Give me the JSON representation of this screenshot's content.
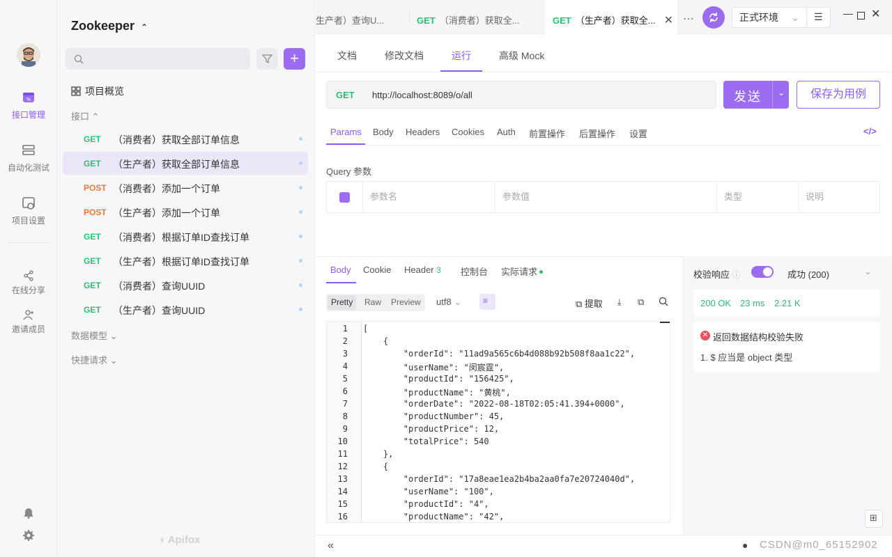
{
  "app": {
    "project_title": "Zookeeper",
    "brand": "Apifox"
  },
  "colors": {
    "accent": "#9b6cf0",
    "get": "#2fbd73",
    "post": "#ee7a32"
  },
  "rail": {
    "items": [
      {
        "label": "接口管理",
        "icon": "api-icon"
      },
      {
        "label": "自动化测试",
        "icon": "test-icon"
      },
      {
        "label": "项目设置",
        "icon": "settings-icon"
      },
      {
        "label": "在线分享",
        "icon": "share-icon"
      },
      {
        "label": "邀请成员",
        "icon": "invite-icon"
      }
    ]
  },
  "sidebar": {
    "search_placeholder": "",
    "overview": "项目概览",
    "interfaces_label": "接口",
    "data_model_label": "数据模型",
    "quick_request_label": "快捷请求",
    "apis": [
      {
        "method": "GET",
        "name": "（消费者）获取全部订单信息"
      },
      {
        "method": "GET",
        "name": "（生产者）获取全部订单信息"
      },
      {
        "method": "POST",
        "name": "（消费者）添加一个订单"
      },
      {
        "method": "POST",
        "name": "（生产者）添加一个订单"
      },
      {
        "method": "GET",
        "name": "（消费者）根据订单ID查找订单"
      },
      {
        "method": "GET",
        "name": "（生产者）根据订单ID查找订单"
      },
      {
        "method": "GET",
        "name": "（消费者）查询UUID"
      },
      {
        "method": "GET",
        "name": "（生产者）查询UUID"
      }
    ]
  },
  "tabs": [
    {
      "method": "",
      "label": "生产者）查询U..."
    },
    {
      "method": "GET",
      "label": "（消费者）获取全..."
    },
    {
      "method": "GET",
      "label": "（生产者）获取全..."
    }
  ],
  "env": {
    "selected": "正式环境"
  },
  "doc_tabs": [
    "文档",
    "修改文档",
    "运行",
    "高级 Mock"
  ],
  "request": {
    "method": "GET",
    "url": "http://localhost:8089/o/all",
    "send": "发送",
    "save": "保存为用例"
  },
  "param_tabs": [
    "Params",
    "Body",
    "Headers",
    "Cookies",
    "Auth",
    "前置操作",
    "后置操作",
    "设置"
  ],
  "query": {
    "title": "Query 参数",
    "columns": [
      "参数名",
      "参数值",
      "类型",
      "说明"
    ]
  },
  "response_tabs": {
    "body": "Body",
    "cookie": "Cookie",
    "header": "Header",
    "header_count": "3",
    "console": "控制台",
    "actual": "实际请求"
  },
  "view_modes": {
    "pretty": "Pretty",
    "raw": "Raw",
    "preview": "Preview",
    "encoding": "utf8",
    "extract": "提取"
  },
  "code_lines": [
    "[",
    "    {",
    "        \"orderId\": \"11ad9a565c6b4d088b92b508f8aa1c22\",",
    "        \"userName\": \"闵宸霆\",",
    "        \"productId\": \"156425\",",
    "        \"productName\": \"黄桃\",",
    "        \"orderDate\": \"2022-08-18T02:05:41.394+0000\",",
    "        \"productNumber\": 45,",
    "        \"productPrice\": 12,",
    "        \"totalPrice\": 540",
    "    },",
    "    {",
    "        \"orderId\": \"17a8eae1ea2b4ba2aa0fa7e20724040d\",",
    "        \"userName\": \"100\",",
    "        \"productId\": \"4\",",
    "        \"productName\": \"42\","
  ],
  "validation": {
    "label": "校验响应",
    "result": "成功 (200)",
    "status": "200 OK",
    "time": "23 ms",
    "size": "2.21 K",
    "error_title": "返回数据结构校验失败",
    "error_detail": "1. $ 应当是 object 类型"
  },
  "footer": {
    "watermark": "CSDN@m0_65152902"
  }
}
